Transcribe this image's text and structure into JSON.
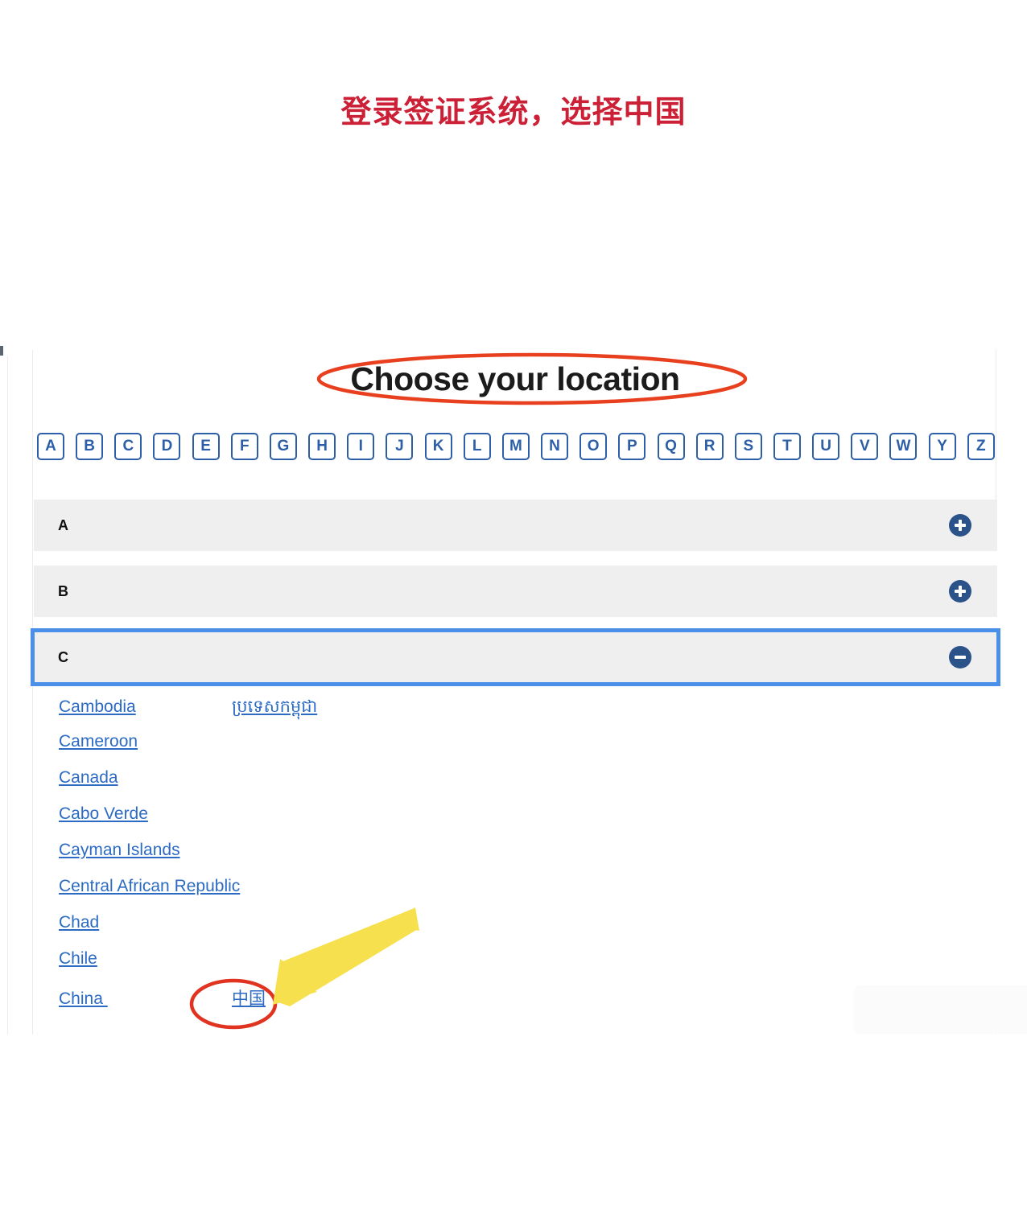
{
  "annotation": {
    "title": "登录签证系统，选择中国",
    "title_color": "#cc2036",
    "ellipse_color": "#e8401f",
    "circle_color": "#e03420",
    "arrow_color": "#f7e04e"
  },
  "page": {
    "title": "Choose your location"
  },
  "alphabet_nav": {
    "letters": [
      "A",
      "B",
      "C",
      "D",
      "E",
      "F",
      "G",
      "H",
      "I",
      "J",
      "K",
      "L",
      "M",
      "N",
      "O",
      "P",
      "Q",
      "R",
      "S",
      "T",
      "U",
      "V",
      "W",
      "Y",
      "Z"
    ]
  },
  "accordion": {
    "sections": [
      {
        "label": "A",
        "expanded": false,
        "icon": "plus-icon",
        "focused": false,
        "countries": []
      },
      {
        "label": "B",
        "expanded": false,
        "icon": "plus-icon",
        "focused": false,
        "countries": []
      },
      {
        "label": "C",
        "expanded": true,
        "icon": "minus-icon",
        "focused": true,
        "countries": [
          {
            "name": "Cambodia",
            "alt": "ប្រទេសកម្ពុជា"
          },
          {
            "name": "Cameroon",
            "alt": ""
          },
          {
            "name": "Canada",
            "alt": ""
          },
          {
            "name": "Cabo Verde",
            "alt": ""
          },
          {
            "name": "Cayman Islands",
            "alt": ""
          },
          {
            "name": "Central African Republic",
            "alt": ""
          },
          {
            "name": "Chad",
            "alt": ""
          },
          {
            "name": "Chile",
            "alt": ""
          },
          {
            "name": "China ",
            "alt": "中国"
          }
        ]
      }
    ]
  },
  "colors": {
    "link": "#2c6bc4",
    "accordion_header_bg": "#efefef",
    "accordion_icon_bg": "#2c5389",
    "letter_button_border": "#2c5fa8",
    "focus_ring": "#4a90e8"
  }
}
